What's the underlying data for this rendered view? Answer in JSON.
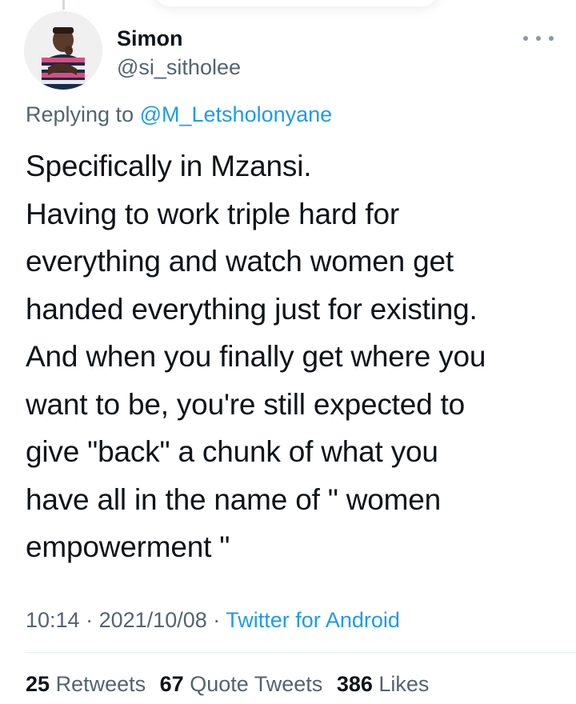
{
  "tweet": {
    "author_name": "Simon",
    "author_handle": "@si_sitholee",
    "reply_prefix": "Replying to",
    "reply_to": "@M_Letsholonyane",
    "text_lines": [
      "Specifically in Mzansi.",
      "Having to work triple hard for",
      "everything and watch women get",
      "handed everything just for existing.",
      "And when you finally get where you",
      "want to be, you're still expected to",
      "give \"back\" a chunk of what you",
      "have all in the name of \" women",
      "empowerment \""
    ],
    "time": "10:14",
    "date": "2021/10/08",
    "separator": "·",
    "source": "Twitter for Android"
  },
  "stats": {
    "retweets_count": "25",
    "retweets_label": "Retweets",
    "quote_count": "67",
    "quote_label": "Quote Tweets",
    "likes_count": "386",
    "likes_label": "Likes"
  },
  "icons": {
    "more": "more-horizontal-icon",
    "avatar": "profile-photo"
  },
  "colors": {
    "link": "#1d9bf0",
    "secondary_text": "#536471",
    "primary_text": "#0f1419"
  }
}
